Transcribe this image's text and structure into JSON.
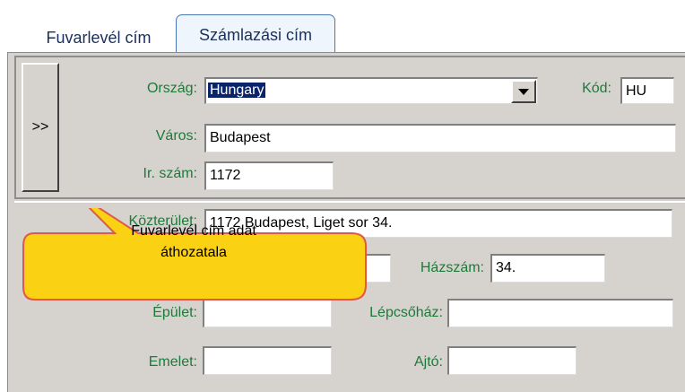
{
  "tabs": {
    "shipping_label": "Fuvarlevél cím",
    "billing_label": "Számlazási cím"
  },
  "copy_button": {
    "label": ">>"
  },
  "country": {
    "label": "Ország:",
    "value": "Hungary"
  },
  "code": {
    "label": "Kód:",
    "value": "HU"
  },
  "city": {
    "label": "Város:",
    "value": "Budapest"
  },
  "zip": {
    "label": "Ir. szám:",
    "value": "1172"
  },
  "street": {
    "label": "Közterület:",
    "value": "1172 Budapest, Liget sor 34."
  },
  "street_type": {
    "value": ""
  },
  "house_number": {
    "label": "Házszám:",
    "value": "34."
  },
  "building": {
    "label": "Épület:",
    "value": ""
  },
  "staircase": {
    "label": "Lépcsőház:",
    "value": ""
  },
  "floor": {
    "label": "Emelet:",
    "value": ""
  },
  "door": {
    "label": "Ajtó:",
    "value": ""
  },
  "tooltip": {
    "text": "Fuvarlevél cím adat áthozatala"
  },
  "colors": {
    "label_green": "#1d7a3a",
    "callout_fill": "#fbd113",
    "callout_border": "#e2574c"
  }
}
